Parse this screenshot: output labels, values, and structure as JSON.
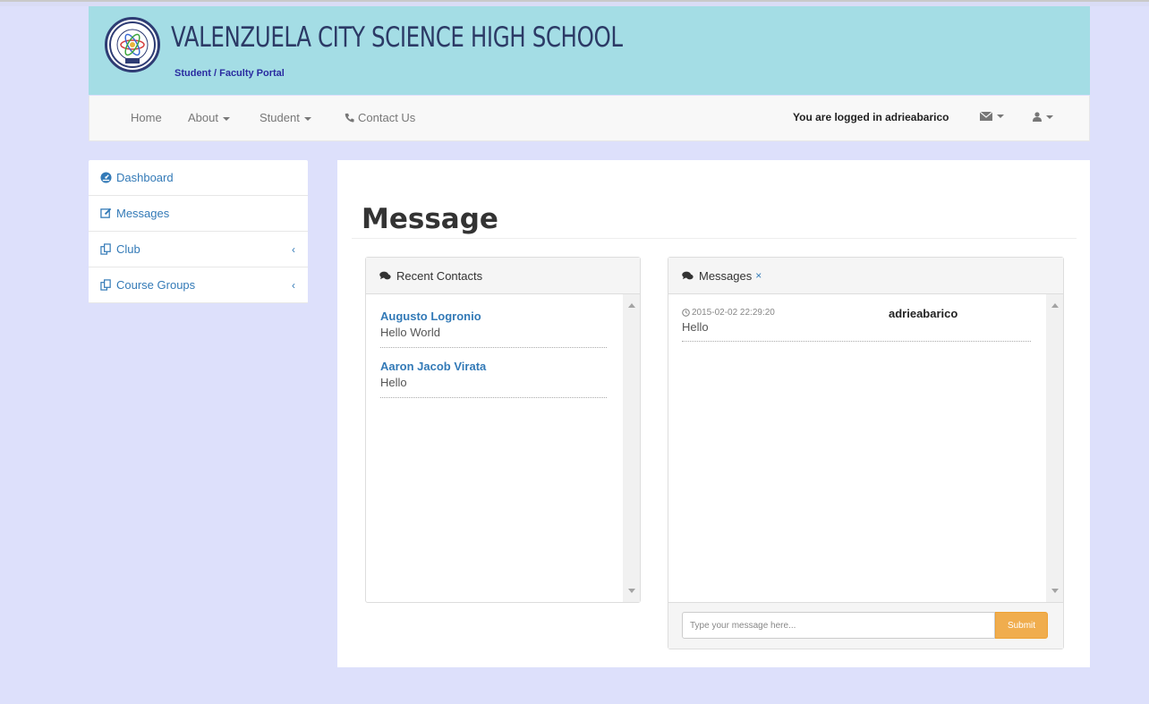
{
  "header": {
    "school_name": "VALENZUELA CITY SCIENCE HIGH SCHOOL",
    "subtitle": "Student / Faculty Portal"
  },
  "nav": {
    "items": [
      {
        "label": "Home"
      },
      {
        "label": "About"
      },
      {
        "label": "Student"
      },
      {
        "label": "Contact Us"
      }
    ],
    "logged_in_text": "You are logged in adrieabarico"
  },
  "sidebar": {
    "items": [
      {
        "label": "Dashboard",
        "icon": "dashboard-icon"
      },
      {
        "label": "Messages",
        "icon": "edit-icon"
      },
      {
        "label": "Club",
        "icon": "copy-icon"
      },
      {
        "label": "Course Groups",
        "icon": "copy-icon"
      }
    ]
  },
  "main": {
    "title": "Message",
    "recent_contacts": {
      "heading": "Recent Contacts",
      "contacts": [
        {
          "name": "Augusto Logronio",
          "message": "Hello World"
        },
        {
          "name": "Aaron Jacob Virata",
          "message": "Hello"
        }
      ]
    },
    "messages": {
      "heading": "Messages",
      "close": "×",
      "entries": [
        {
          "time": "2015-02-02 22:29:20",
          "user": "adrieabarico",
          "text": "Hello"
        }
      ],
      "input_placeholder": "Type your message here...",
      "submit_label": "Submit"
    }
  },
  "colors": {
    "background": "#dde0fb",
    "header": "#a4dde5",
    "link": "#337ab7",
    "submit": "#f0ad4e"
  }
}
